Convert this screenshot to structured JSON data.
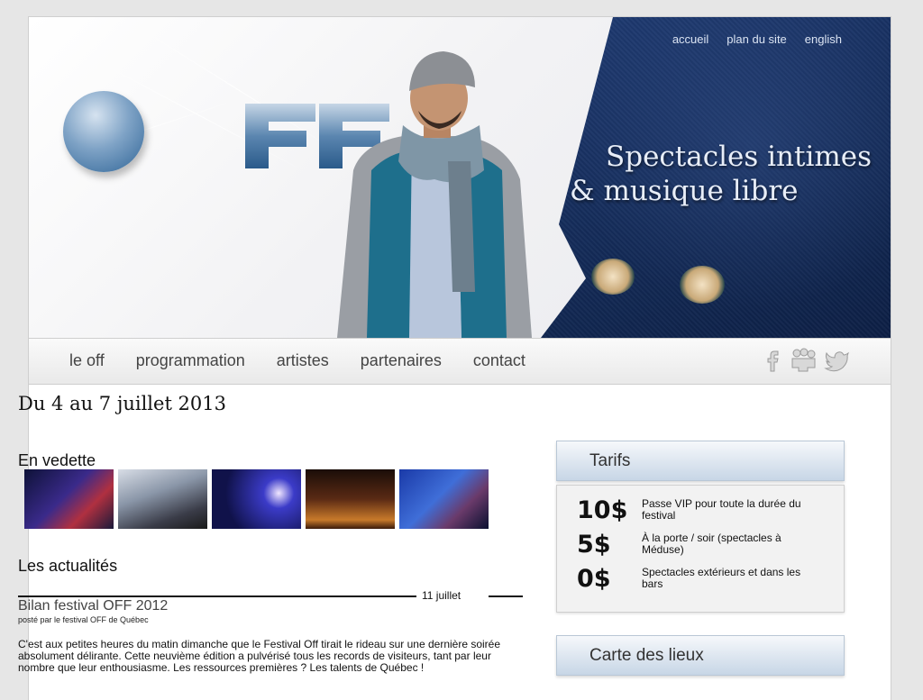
{
  "banner": {
    "top_links": [
      "accueil",
      "plan du site",
      "english"
    ],
    "tagline_line1": "Spectacles intimes",
    "tagline_line2": "& musique libre",
    "logo_text": "FF"
  },
  "nav": {
    "items": [
      "le off",
      "programmation",
      "artistes",
      "partenaires",
      "contact"
    ],
    "social_icons": [
      "facebook-icon",
      "myspace-icon",
      "twitter-icon"
    ]
  },
  "main": {
    "date_heading": "Du 4 au 7 juillet 2013",
    "featured_title": "En vedette",
    "news_title": "Les actualités",
    "post": {
      "date": "11 juillet",
      "title": "Bilan festival OFF 2012",
      "byline": "posté par le festival OFF de Québec",
      "body": "C'est aux petites heures du matin dimanche que le Festival Off tirait le rideau sur une dernière soirée absolument délirante. Cette neuvième édition a pulvérisé tous les records de visiteurs, tant par leur nombre que leur enthousiasme. Les ressources premières ? Les talents de Québec !"
    }
  },
  "sidebar": {
    "tarifs_title": "Tarifs",
    "tarifs": [
      {
        "price": "10$",
        "desc": "Passe VIP pour toute la durée du festival"
      },
      {
        "price": "5$",
        "desc": "À la porte / soir (spectacles à Méduse)"
      },
      {
        "price": "0$",
        "desc": "Spectacles extérieurs et dans les bars"
      }
    ],
    "map_title": "Carte des lieux"
  },
  "colors": {
    "banner_blue": "#142b58",
    "sidebar_head": "#c7d6e6",
    "logo_blue": "#2f6496"
  }
}
